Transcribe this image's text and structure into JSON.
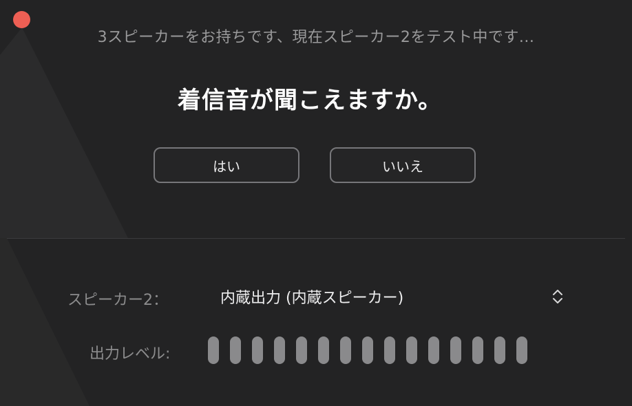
{
  "window": {
    "close_color": "#ee5f54"
  },
  "status_text": "3スピーカーをお持ちです、現在スピーカー2をテスト中です...",
  "question": "着信音が聞こえますか。",
  "buttons": {
    "yes_label": "はい",
    "no_label": "いいえ"
  },
  "speaker": {
    "label": "スピーカー2：",
    "selected": "内蔵出力 (内蔵スピーカー)",
    "icon": "chevron-up-down-icon"
  },
  "output_level": {
    "label": "出力レベル:",
    "segments": 15,
    "active_segments": 0,
    "inactive_color": "#8a8a8c"
  }
}
